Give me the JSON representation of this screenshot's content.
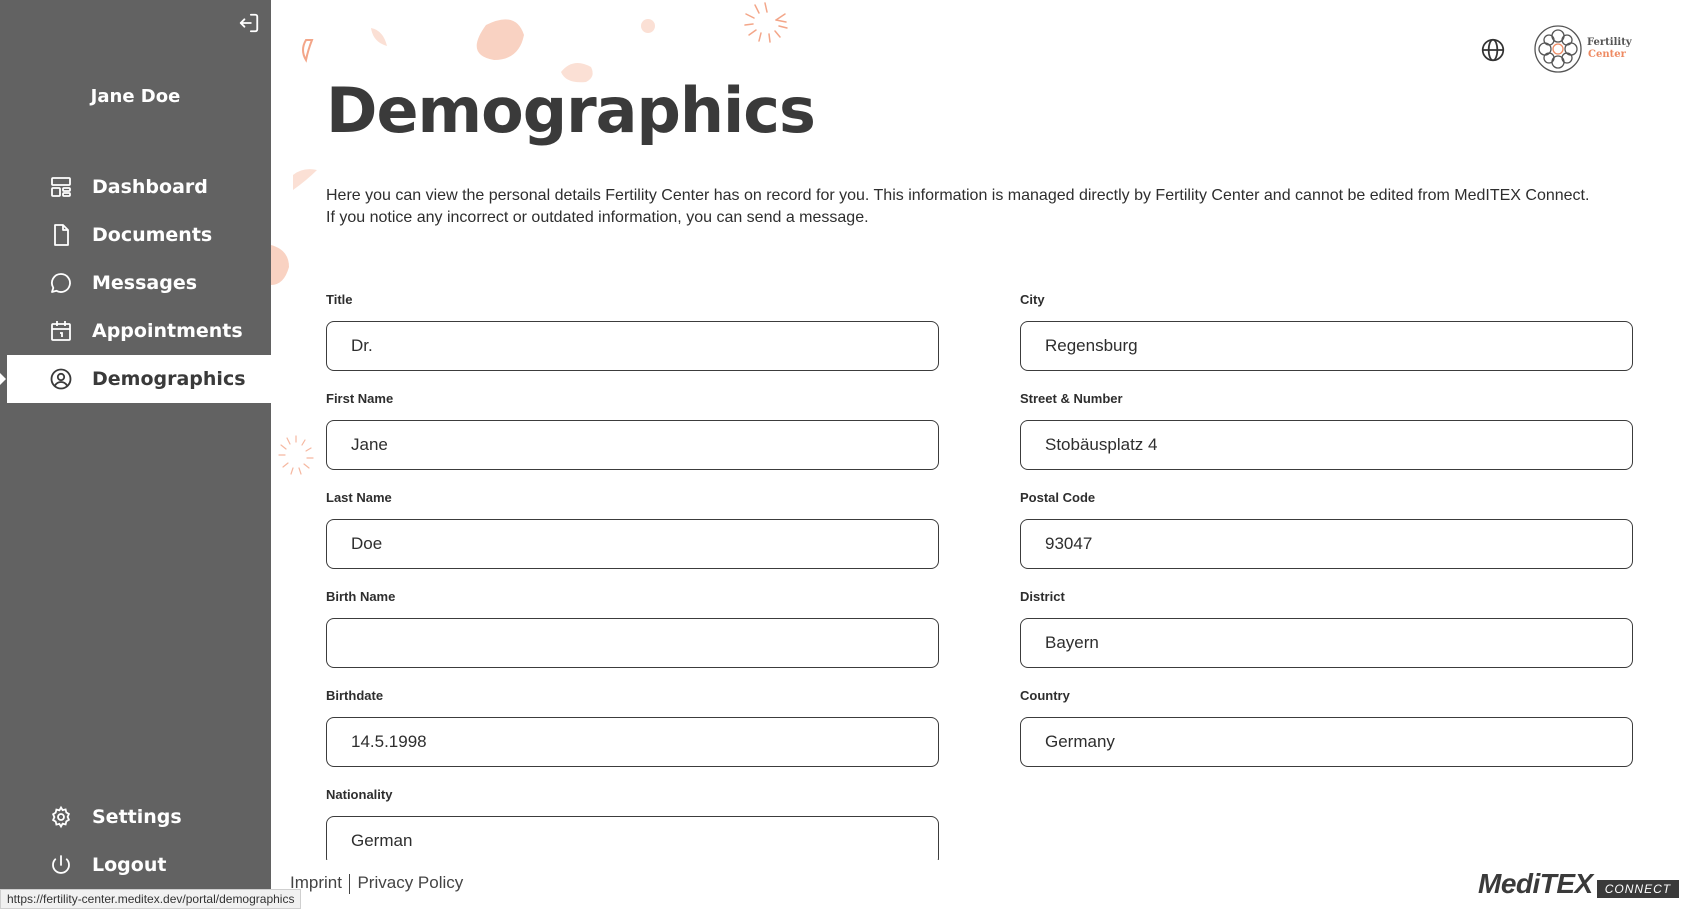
{
  "sidebar": {
    "user_name": "Jane Doe",
    "nav": [
      {
        "label": "Dashboard",
        "icon": "dashboard-icon"
      },
      {
        "label": "Documents",
        "icon": "document-icon"
      },
      {
        "label": "Messages",
        "icon": "message-icon"
      },
      {
        "label": "Appointments",
        "icon": "calendar-icon"
      },
      {
        "label": "Demographics",
        "icon": "user-circle-icon",
        "active": true
      }
    ],
    "bottom": [
      {
        "label": "Settings",
        "icon": "gear-icon"
      },
      {
        "label": "Logout",
        "icon": "power-icon"
      }
    ]
  },
  "header": {
    "title": "Demographics",
    "logo_line1": "Fertility",
    "logo_line2": "Center"
  },
  "intro": {
    "line1": "Here you can view the personal details Fertility Center has on record for you. This information is managed directly by Fertility Center and cannot be edited from MedITEX Connect.",
    "line2": "If you notice any incorrect or outdated information, you can send a message."
  },
  "form": {
    "left": [
      {
        "label": "Title",
        "value": "Dr."
      },
      {
        "label": "First Name",
        "value": "Jane"
      },
      {
        "label": "Last Name",
        "value": "Doe"
      },
      {
        "label": "Birth Name",
        "value": ""
      },
      {
        "label": "Birthdate",
        "value": "14.5.1998"
      },
      {
        "label": "Nationality",
        "value": "German"
      }
    ],
    "right": [
      {
        "label": "City",
        "value": "Regensburg"
      },
      {
        "label": "Street & Number",
        "value": "Stobäusplatz 4"
      },
      {
        "label": "Postal Code",
        "value": "93047"
      },
      {
        "label": "District",
        "value": "Bayern"
      },
      {
        "label": "Country",
        "value": "Germany"
      }
    ]
  },
  "footer": {
    "imprint": "Imprint",
    "privacy": "Privacy Policy",
    "status_url": "https://fertility-center.meditex.dev/portal/demographics",
    "brand": "MediTEX",
    "brand_tag": "CONNECT"
  },
  "colors": {
    "sidebar_bg": "#626262",
    "accent": "#ee8a62",
    "text": "#2e2e2e"
  }
}
